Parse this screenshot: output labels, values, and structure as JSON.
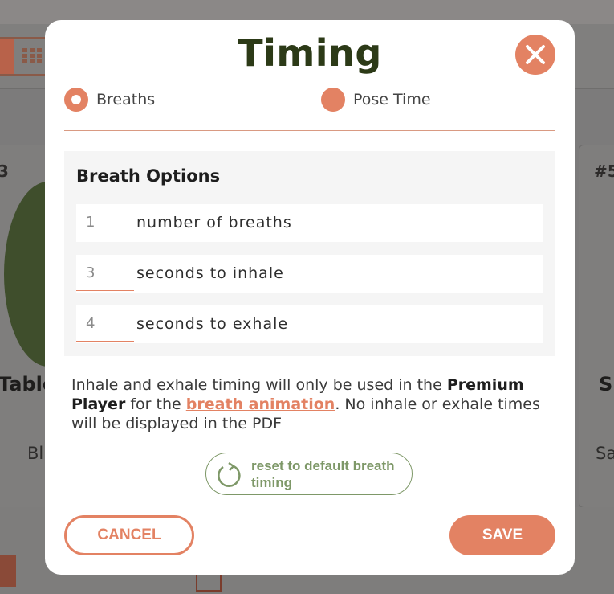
{
  "background": {
    "left_card_number": "3",
    "left_card_title": "Table",
    "left_card_sub": "Bl",
    "right_card_number": "#5",
    "right_card_title": "S",
    "right_card_sub": "Sa"
  },
  "modal": {
    "title": "Timing",
    "close_icon": "close-icon",
    "mode_options": [
      {
        "label": "Breaths",
        "selected": true
      },
      {
        "label": "Pose Time",
        "selected": false
      }
    ],
    "breath_options": {
      "title": "Breath Options",
      "rows": [
        {
          "value": "1",
          "label": "number of breaths"
        },
        {
          "value": "3",
          "label": "seconds to inhale"
        },
        {
          "value": "4",
          "label": "seconds to exhale"
        }
      ]
    },
    "info": {
      "part1": "Inhale and exhale timing will only be used in the ",
      "bold": "Premium Player",
      "part2": " for the ",
      "link": "breath animation",
      "part3": ". No inhale or exhale times will be displayed in the PDF"
    },
    "reset_label": "reset to default breath timing",
    "cancel_label": "CANCEL",
    "save_label": "SAVE"
  },
  "colors": {
    "accent": "#e38263",
    "title_green": "#2c3a17",
    "reset_green": "#7e9868",
    "overlay": "#7c7b7b"
  }
}
